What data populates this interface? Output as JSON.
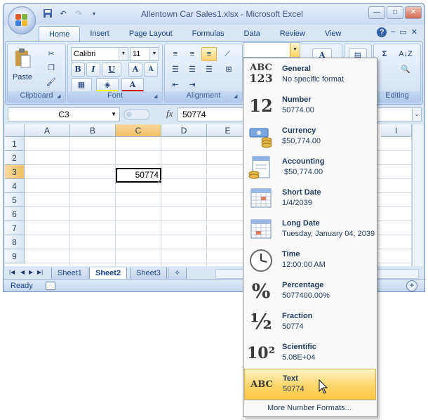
{
  "window": {
    "title": "Allentown Car Sales1.xlsx - Microsoft Excel",
    "quick_access": [
      "save",
      "undo",
      "redo",
      "customize"
    ]
  },
  "tabs": [
    "Home",
    "Insert",
    "Page Layout",
    "Formulas",
    "Data",
    "Review",
    "View"
  ],
  "active_tab": "Home",
  "ribbon": {
    "clipboard": {
      "paste_label": "Paste",
      "group_label": "Clipboard"
    },
    "font": {
      "font_name": "Calibri",
      "font_size": "11",
      "bold": "B",
      "italic": "I",
      "underline": "U",
      "grow": "A",
      "shrink": "A",
      "group_label": "Font"
    },
    "alignment": {
      "group_label": "Alignment"
    },
    "editing": {
      "group_label": "Editing",
      "sum_symbol": "Σ"
    }
  },
  "formula_bar": {
    "name_box": "C3",
    "fx": "fx",
    "content": "50774"
  },
  "grid": {
    "columns": [
      "A",
      "B",
      "C",
      "D",
      "E",
      "I"
    ],
    "rows": [
      "1",
      "2",
      "3",
      "4",
      "5",
      "6",
      "7",
      "8",
      "9"
    ],
    "active_cell": {
      "ref": "C3",
      "value": "50774"
    }
  },
  "sheets": [
    "Sheet1",
    "Sheet2",
    "Sheet3"
  ],
  "active_sheet": "Sheet2",
  "status": {
    "text": "Ready",
    "zoom_plus": "+"
  },
  "number_format_menu": {
    "items": [
      {
        "title": "General",
        "value": "No specific format",
        "icon": "general-icon",
        "icon_text_top": "ABC",
        "icon_text_bottom": "123"
      },
      {
        "title": "Number",
        "value": "50774.00",
        "icon": "number-icon",
        "icon_text": "12"
      },
      {
        "title": "Currency",
        "value": "$50,774.00",
        "icon": "currency-icon"
      },
      {
        "title": "Accounting",
        "value": " $50,774.00",
        "icon": "accounting-icon"
      },
      {
        "title": "Short Date",
        "value": "1/4/2039",
        "icon": "calendar-icon"
      },
      {
        "title": "Long Date",
        "value": "Tuesday, January 04, 2039",
        "icon": "calendar-icon"
      },
      {
        "title": "Time",
        "value": "12:00:00 AM",
        "icon": "clock-icon"
      },
      {
        "title": "Percentage",
        "value": "5077400.00%",
        "icon": "percent-icon",
        "icon_text": "%"
      },
      {
        "title": "Fraction",
        "value": "50774",
        "icon": "fraction-icon",
        "icon_text": "½"
      },
      {
        "title": "Scientific",
        "value": "5.08E+04",
        "icon": "scientific-icon",
        "icon_text": "10²"
      },
      {
        "title": "Text",
        "value": "50774",
        "icon": "text-format-icon",
        "icon_text": "ABC"
      }
    ],
    "hovered": "Text",
    "more_label": "More Number Formats..."
  },
  "colors": {
    "ribbon_text": "#15428b",
    "hover_gold": "#ffd66b",
    "active_header": "#f1c15f"
  }
}
